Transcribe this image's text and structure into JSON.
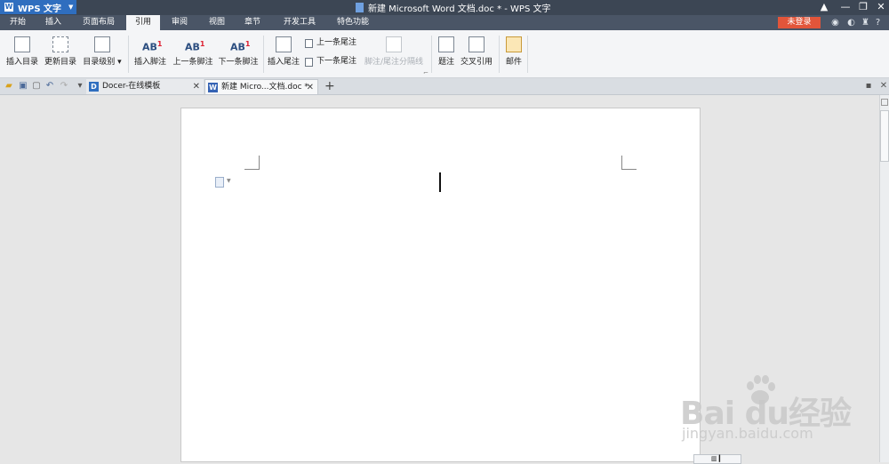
{
  "app": {
    "name": "WPS 文字",
    "logo_letter": "W"
  },
  "window": {
    "title": "新建 Microsoft Word 文档.doc * - WPS 文字"
  },
  "ribbon_tabs": [
    "开始",
    "插入",
    "页面布局",
    "引用",
    "审阅",
    "视图",
    "章节",
    "开发工具",
    "特色功能"
  ],
  "active_tab_index": 3,
  "login_label": "未登录",
  "toolbar": {
    "insert_toc": "插入目录",
    "update_toc": "更新目录",
    "toc_level": "目录级别",
    "insert_footnote": "插入脚注",
    "prev_footnote": "上一条脚注",
    "next_footnote": "下一条脚注",
    "insert_endnote": "插入尾注",
    "prev_endnote": "上一条尾注",
    "next_endnote": "下一条尾注",
    "separator_line": "脚注/尾注分隔线",
    "caption": "题注",
    "cross_ref": "交叉引用",
    "mail": "邮件",
    "ab_glyph": "AB",
    "ab_sup": "1"
  },
  "doc_tabs": [
    {
      "label": "Docer-在线模板",
      "icon": "D"
    },
    {
      "label": "新建 Micro...文档.doc *",
      "icon": "W"
    }
  ],
  "new_tab_symbol": "+",
  "watermark": {
    "logo": "Bai du经验",
    "sub": "jingyan.baidu.com"
  }
}
